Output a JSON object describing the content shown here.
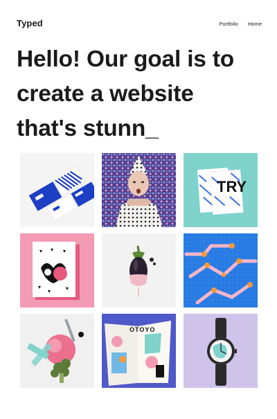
{
  "header": {
    "logo": "Typed",
    "nav": [
      {
        "label": "Portfolio"
      },
      {
        "label": "Home"
      }
    ]
  },
  "hero": {
    "text": "Hello! Our goal is to create a website that's stunn_"
  },
  "portfolio": {
    "items": [
      {
        "icon": "business-cards-image",
        "bg": "#f4f4f4"
      },
      {
        "icon": "portrait-image",
        "bg": "#5a4f9c"
      },
      {
        "icon": "magazine-try-image",
        "bg": "#7fd3cb"
      },
      {
        "icon": "poster-pink-image",
        "bg": "#f39ab4"
      },
      {
        "icon": "eggplant-image",
        "bg": "#f2f2f2"
      },
      {
        "icon": "tubes-image",
        "bg": "#2a7ee6"
      },
      {
        "icon": "collage-broccoli-image",
        "bg": "#f0f0f0"
      },
      {
        "icon": "otoyo-magazine-image",
        "bg": "#4f59c9"
      },
      {
        "icon": "watch-image",
        "bg": "#cfc3ea"
      }
    ],
    "magazine_letters": "TRY",
    "otoyo_title": "OTOYO"
  }
}
